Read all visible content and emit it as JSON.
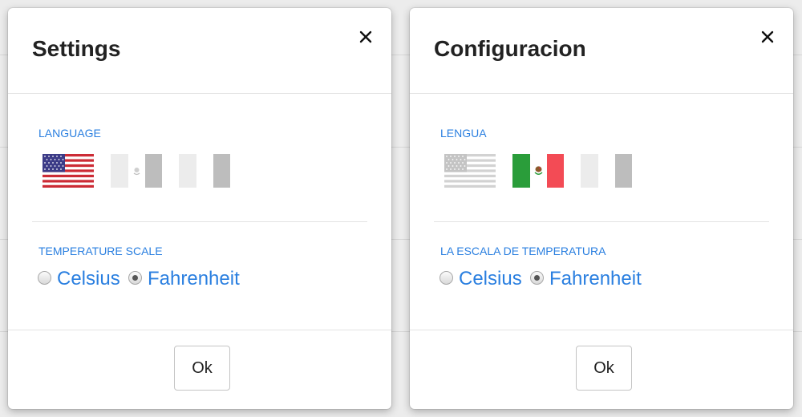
{
  "dialogs": [
    {
      "title": "Settings",
      "language_label": "LANGUAGE",
      "temperature_label": "TEMPERATURE SCALE",
      "options": [
        "Celsius",
        "Fahrenheit"
      ],
      "selected_option": "Fahrenheit",
      "selected_flag": "us-flag",
      "ok_label": "Ok"
    },
    {
      "title": "Configuracion",
      "language_label": "LENGUA",
      "temperature_label": "LA ESCALA DE TEMPERATURA",
      "options": [
        "Celsius",
        "Fahrenheit"
      ],
      "selected_option": "Fahrenheit",
      "selected_flag": "mexico-flag",
      "ok_label": "Ok"
    }
  ],
  "icons": {
    "close": "close-icon",
    "flags": [
      "us-flag-icon",
      "mexico-flag-icon",
      "italy-flag-icon"
    ]
  },
  "colors": {
    "accent": "#2a7fe0",
    "title_text": "#222222",
    "divider": "#e3e3e3",
    "us_red": "#cc2b35",
    "us_blue": "#3c3b87",
    "mexico_green": "#2a9d3a",
    "mexico_red": "#f34b55",
    "inactive_flag_light": "#ececec",
    "inactive_flag_dark": "#bdbdbd"
  }
}
